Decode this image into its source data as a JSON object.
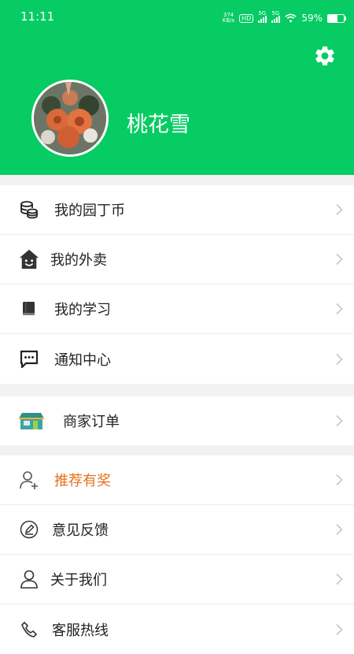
{
  "status_bar": {
    "time": "11:11",
    "net_speed": "374",
    "net_unit": "KB/s",
    "hd": "HD",
    "sim1": "5G",
    "sim2": "5G",
    "battery": "59%"
  },
  "profile": {
    "username": "桃花雪"
  },
  "menu_group_1": [
    {
      "label": "我的园丁币",
      "icon": "coins-icon"
    },
    {
      "label": "我的外卖",
      "icon": "house-face-icon"
    },
    {
      "label": "我的学习",
      "icon": "book-icon"
    },
    {
      "label": "通知中心",
      "icon": "chat-bubble-icon"
    }
  ],
  "menu_group_2": [
    {
      "label": "商家订单",
      "icon": "shop-icon"
    }
  ],
  "menu_group_3": [
    {
      "label": "推荐有奖",
      "icon": "add-user-icon"
    },
    {
      "label": "意见反馈",
      "icon": "edit-circle-icon"
    },
    {
      "label": "关于我们",
      "icon": "user-icon"
    },
    {
      "label": "客服热线",
      "icon": "phone-icon"
    }
  ],
  "colors": {
    "brand": "#06cc63",
    "highlight_label": "#e8711c"
  }
}
